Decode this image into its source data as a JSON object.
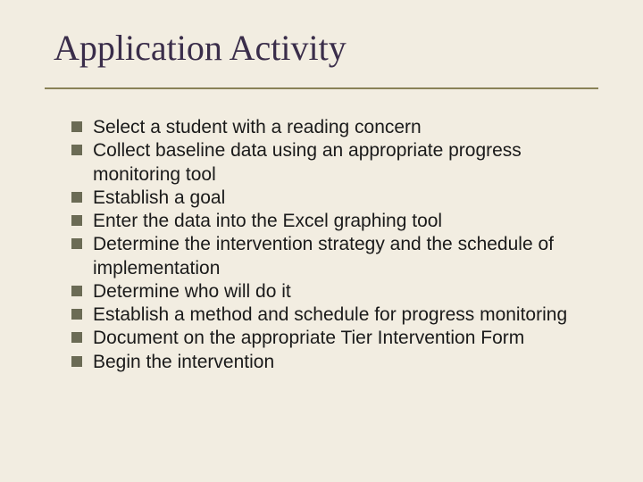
{
  "title": "Application Activity",
  "items": [
    "Select a student with a reading concern",
    "Collect baseline data using an appropriate progress monitoring tool",
    "Establish a goal",
    "Enter the data into the Excel graphing tool",
    "Determine the intervention strategy and the  schedule of implementation",
    "Determine who will do it",
    "Establish a method and schedule for progress monitoring",
    "Document on the appropriate Tier Intervention Form",
    "Begin the intervention"
  ]
}
